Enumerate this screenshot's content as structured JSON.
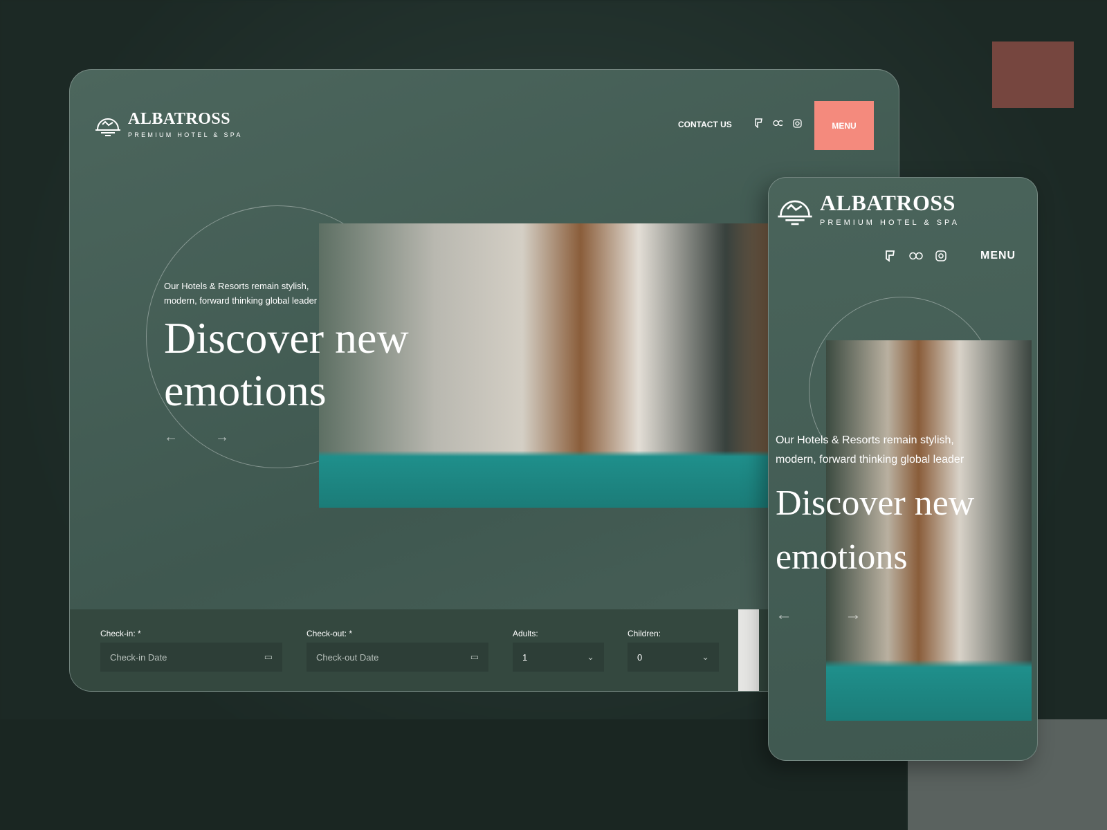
{
  "brand": {
    "name": "ALBATROSS",
    "tagline": "PREMIUM HOTEL & SPA"
  },
  "nav": {
    "contact": "CONTACT US",
    "menu": "MENU",
    "social_icons": [
      "foursquare-icon",
      "tripadvisor-icon",
      "instagram-icon"
    ]
  },
  "hero": {
    "subtitle_line1": "Our Hotels & Resorts remain stylish,",
    "subtitle_line2": "modern, forward thinking global leader",
    "title_line1": "Discover new",
    "title_line2": "emotions",
    "prev": "←",
    "next": "→"
  },
  "booking": {
    "checkin": {
      "label": "Check-in:",
      "required": "*",
      "placeholder": "Check-in Date"
    },
    "checkout": {
      "label": "Check-out:",
      "required": "*",
      "placeholder": "Check-out Date"
    },
    "adults": {
      "label": "Adults:",
      "value": "1"
    },
    "children": {
      "label": "Children:",
      "value": "0"
    }
  },
  "colors": {
    "accent": "#f48a7d",
    "panel": "#455f56",
    "booking_bar": "#34483f"
  }
}
